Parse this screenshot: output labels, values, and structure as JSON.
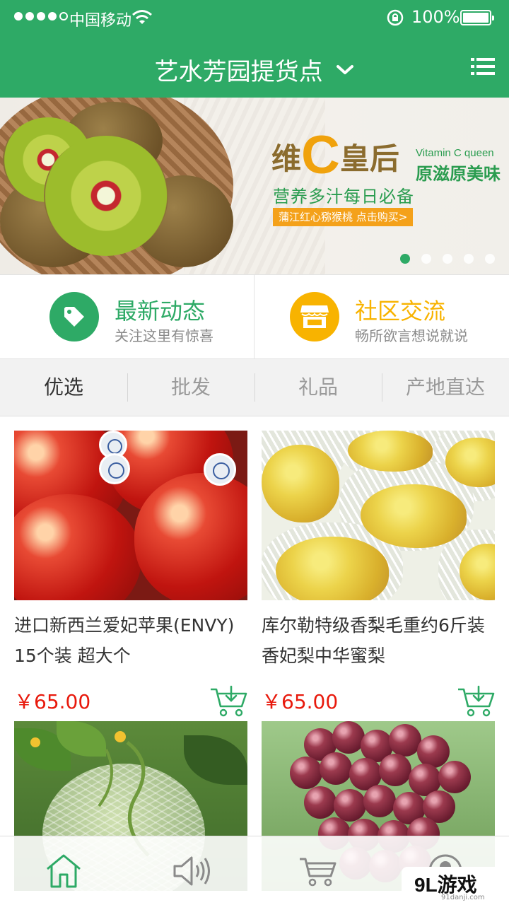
{
  "status_bar": {
    "carrier": "中国移动",
    "battery": "100%",
    "signal_bars": 4,
    "icons": [
      "signal-dots",
      "wifi-icon",
      "rotation-lock-icon",
      "battery-icon"
    ]
  },
  "nav": {
    "title": "艺水芳园提货点",
    "dropdown_icon": "chevron-down-icon",
    "menu_icon": "list-menu-icon"
  },
  "banner": {
    "title_part1": "维",
    "title_c": "C",
    "title_part2": "皇后",
    "title_en": "Vitamin C queen",
    "tagline": "原滋原美味",
    "subtitle": "营养多汁每日必备",
    "cta": "蒲江红心猕猴桃  点击购买>",
    "slide_count": 5,
    "active_slide": 1
  },
  "features": [
    {
      "title": "最新动态",
      "subtitle": "关注这里有惊喜",
      "icon": "tag-icon",
      "color": "#2eaa66"
    },
    {
      "title": "社区交流",
      "subtitle": "畅所欲言想说就说",
      "icon": "store-icon",
      "color": "#f8b300"
    }
  ],
  "tabs": [
    {
      "label": "优选",
      "active": true
    },
    {
      "label": "批发",
      "active": false
    },
    {
      "label": "礼品",
      "active": false
    },
    {
      "label": "产地直达",
      "active": false
    }
  ],
  "products": [
    {
      "name": "进口新西兰爱妃苹果(ENVY) 15个装 超大个",
      "price": "￥65.00",
      "image": "apples",
      "cart_icon": "add-to-cart-icon"
    },
    {
      "name": "库尔勒特级香梨毛重约6斤装 香妃梨中华蜜梨",
      "price": "￥65.00",
      "image": "pears",
      "cart_icon": "add-to-cart-icon"
    },
    {
      "name": "",
      "price": "",
      "image": "cantaloupe"
    },
    {
      "name": "",
      "price": "",
      "image": "grapes"
    }
  ],
  "tabbar": {
    "items": [
      "home-icon",
      "speaker-icon",
      "cart-icon",
      "profile-icon"
    ],
    "active": "home-icon"
  },
  "watermark": {
    "logo": "9L游戏",
    "url": "91danji.com"
  },
  "colors": {
    "brand_green": "#2eaa66",
    "orange": "#f8b300",
    "price_red": "#e8190c"
  }
}
